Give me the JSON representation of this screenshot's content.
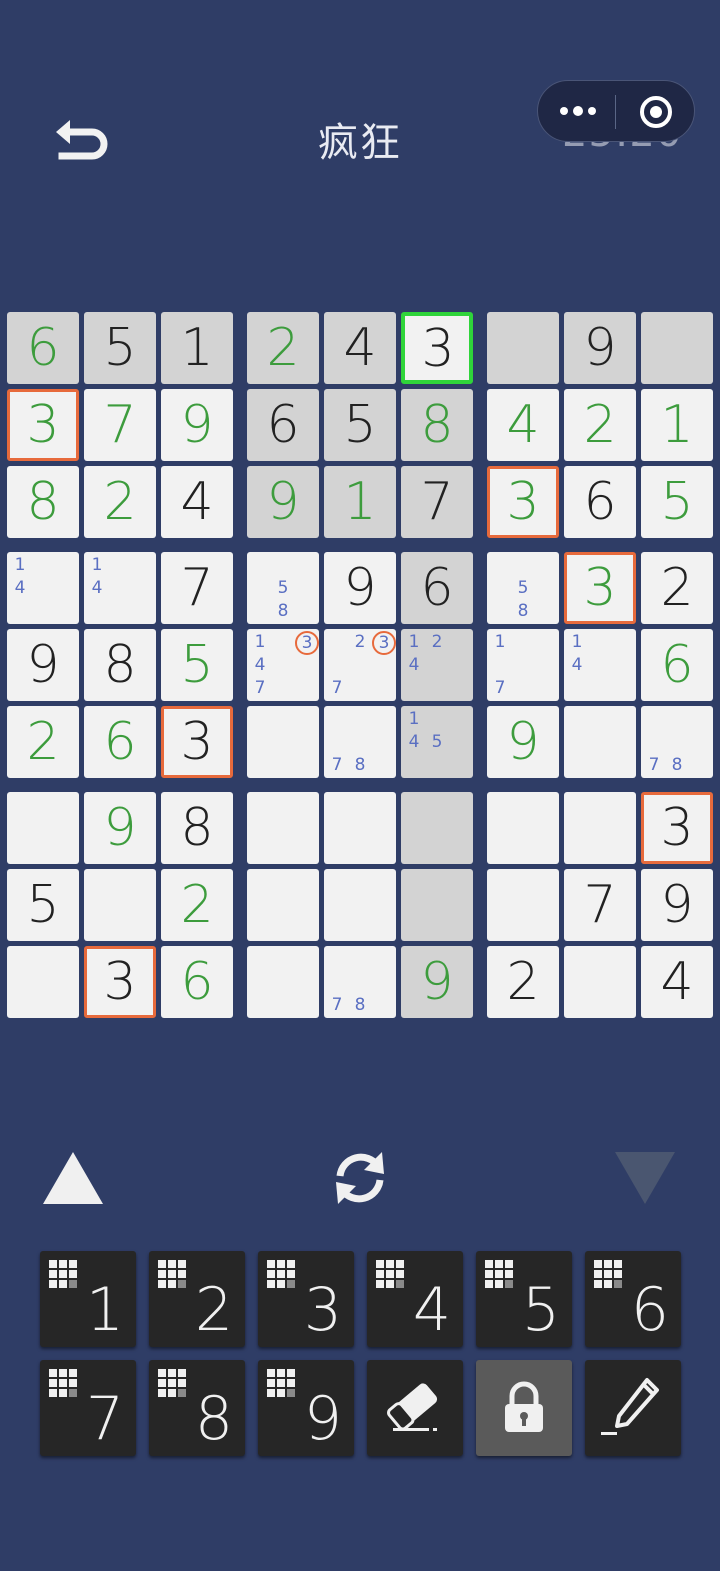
{
  "header": {
    "title": "疯狂",
    "timer": "25:20"
  },
  "icons": {
    "back": "undo-arrow-icon",
    "more": "more-dots-icon",
    "close": "target-circle-icon",
    "up": "triangle-up-icon",
    "refresh": "refresh-icon",
    "down": "triangle-down-icon",
    "eraser": "eraser-icon",
    "lock": "lock-icon",
    "pencil": "pencil-icon"
  },
  "colors": {
    "background": "#2f3d66",
    "given": "#222222",
    "user": "#3d9c3d",
    "note": "#5a6fc2",
    "highlight": "#e76a3c",
    "selected": "#2fd43a"
  },
  "grid": [
    [
      "6",
      "5",
      "1",
      "2",
      "4",
      "3",
      "",
      "9",
      ""
    ],
    [
      "3",
      "7",
      "9",
      "6",
      "5",
      "8",
      "4",
      "2",
      "1"
    ],
    [
      "8",
      "2",
      "4",
      "9",
      "1",
      "7",
      "3",
      "6",
      "5"
    ],
    [
      "",
      "",
      "7",
      "",
      "9",
      "6",
      "",
      "3",
      "2"
    ],
    [
      "9",
      "8",
      "5",
      "",
      "",
      "",
      "",
      "",
      "6"
    ],
    [
      "2",
      "6",
      "3",
      "",
      "",
      "",
      "9",
      "",
      ""
    ],
    [
      "",
      "9",
      "8",
      "",
      "",
      "",
      "",
      "",
      "3"
    ],
    [
      "5",
      "",
      "2",
      "",
      "",
      "",
      "",
      "7",
      "9"
    ],
    [
      "",
      "3",
      "6",
      "",
      "",
      "9",
      "2",
      "",
      "4"
    ]
  ],
  "kinds": [
    "UGGUGG...",
    "UUUGGU UU",
    "UUGUUGUGU",
    "..G.GG.UG",
    "GGU.....U",
    "UUG...U..",
    ".UG.....G",
    "G.U....GG",
    ".GU..UG.G"
  ],
  "shade": [
    [
      1,
      1,
      1,
      1,
      1,
      1,
      1,
      1,
      1
    ],
    [
      0,
      0,
      0,
      1,
      1,
      1,
      0,
      0,
      0
    ],
    [
      0,
      0,
      0,
      1,
      1,
      1,
      0,
      0,
      0
    ],
    [
      0,
      0,
      0,
      0,
      0,
      1,
      0,
      0,
      0
    ],
    [
      0,
      0,
      0,
      0,
      0,
      1,
      0,
      0,
      0
    ],
    [
      0,
      0,
      0,
      0,
      0,
      1,
      0,
      0,
      0
    ],
    [
      0,
      0,
      0,
      0,
      0,
      1,
      0,
      0,
      0
    ],
    [
      0,
      0,
      0,
      0,
      0,
      1,
      0,
      0,
      0
    ],
    [
      0,
      0,
      0,
      0,
      0,
      1,
      0,
      0,
      0
    ]
  ],
  "highlight_orange": [
    [
      1,
      0
    ],
    [
      2,
      6
    ],
    [
      3,
      7
    ],
    [
      5,
      2
    ],
    [
      6,
      8
    ],
    [
      8,
      1
    ]
  ],
  "highlight_green": [
    [
      0,
      5
    ]
  ],
  "notes": [
    {
      "r": 3,
      "c": 0,
      "n": [
        "1",
        "",
        "",
        "4"
      ]
    },
    {
      "r": 3,
      "c": 1,
      "n": [
        "1",
        "",
        "",
        "4"
      ]
    },
    {
      "r": 3,
      "c": 3,
      "n": [
        "",
        "",
        "",
        "",
        "5",
        "",
        "",
        "8"
      ]
    },
    {
      "r": 3,
      "c": 6,
      "n": [
        "",
        "",
        "",
        "",
        "5",
        "",
        "",
        "8"
      ]
    },
    {
      "r": 4,
      "c": 3,
      "n": [
        "1",
        "",
        "3*",
        "4",
        "",
        "",
        "7"
      ]
    },
    {
      "r": 4,
      "c": 4,
      "n": [
        "",
        "2",
        "3*",
        "",
        "",
        "",
        "7"
      ]
    },
    {
      "r": 4,
      "c": 5,
      "n": [
        "1",
        "2",
        "",
        "4"
      ]
    },
    {
      "r": 4,
      "c": 6,
      "n": [
        "1",
        "",
        "",
        "",
        "",
        "",
        "7"
      ]
    },
    {
      "r": 4,
      "c": 7,
      "n": [
        "1",
        "",
        "",
        "4"
      ]
    },
    {
      "r": 5,
      "c": 4,
      "n": [
        "",
        "",
        "",
        "",
        "",
        "",
        "7",
        "8"
      ]
    },
    {
      "r": 5,
      "c": 5,
      "n": [
        "1",
        "",
        "",
        "4",
        "5"
      ]
    },
    {
      "r": 5,
      "c": 8,
      "n": [
        "",
        "",
        "",
        "",
        "",
        "",
        "7",
        "8"
      ]
    },
    {
      "r": 8,
      "c": 4,
      "n": [
        "",
        "",
        "",
        "",
        "",
        "",
        "7",
        "8"
      ]
    }
  ],
  "keypad": {
    "digits": [
      "1",
      "2",
      "3",
      "4",
      "5",
      "6",
      "7",
      "8",
      "9"
    ]
  }
}
